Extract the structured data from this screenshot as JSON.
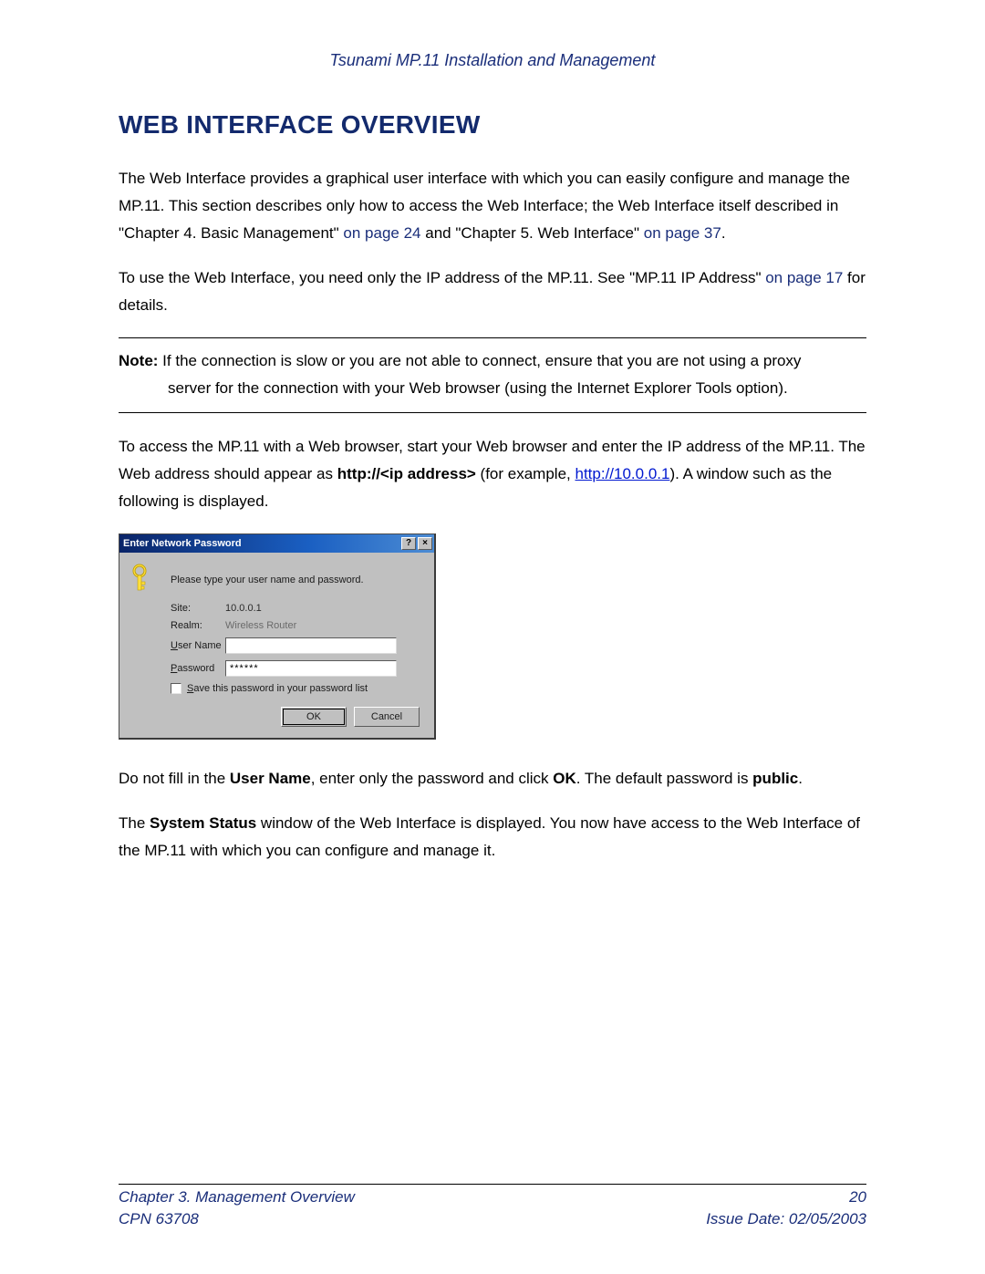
{
  "header": {
    "title": "Tsunami MP.11 Installation and Management"
  },
  "section": {
    "title": "WEB INTERFACE OVERVIEW"
  },
  "para1": {
    "t1": "The Web Interface provides a graphical user interface with which you can easily configure and manage the MP.11.  This section describes only how to access the Web Interface; the Web Interface itself described in   \"Chapter 4.  Basic Management\" ",
    "x1": "on page 24",
    "t2": " and \"Chapter 5.  Web Interface\" ",
    "x2": "on page 37",
    "t3": "."
  },
  "para2": {
    "t1": "To use the Web Interface, you need only the IP address of the MP.11.  See  \"MP.11 IP Address\" ",
    "x1": "on page 17",
    "t2": " for details."
  },
  "note": {
    "label": "Note:",
    "line1": " If the connection is slow or you are not able to connect, ensure that you are not using a proxy",
    "line2": "server for the connection with your Web browser (using the Internet Explorer Tools option)."
  },
  "para3": {
    "t1": "To access the MP.11 with a Web browser, start your Web browser and enter the IP address of the MP.11.  The Web address should appear as ",
    "b1": "http://<ip address>",
    "t2": " (for example, ",
    "link": "http://10.0.0.1",
    "t3": ").  A window such as the following is displayed."
  },
  "dialog": {
    "title": "Enter Network Password",
    "help": "?",
    "close": "×",
    "msg": "Please type your user name and password.",
    "site_label": "Site:",
    "site_value": "10.0.0.1",
    "realm_label": "Realm:",
    "realm_value": "Wireless Router",
    "user_u": "U",
    "user_rest": "ser Name",
    "pass_u": "P",
    "pass_rest": "assword",
    "password_value": "******",
    "save_u": "S",
    "save_rest": "ave this password in your password list",
    "ok": "OK",
    "cancel": "Cancel"
  },
  "para4": {
    "t1": "Do not fill in the ",
    "b1": "User Name",
    "t2": ", enter only the password  and click ",
    "b2": "OK",
    "t3": ".  The default password is ",
    "b3": "public",
    "t4": "."
  },
  "para5": {
    "t1": "The ",
    "b1": "System Status",
    "t2": " window of the Web Interface is displayed.  You now have access to the Web Interface of the MP.11 with which you can configure and manage it."
  },
  "footer": {
    "chapter": "Chapter 3.  Management Overview",
    "page": "20",
    "cpn": "CPN 63708",
    "issue": "Issue Date:  02/05/2003"
  }
}
